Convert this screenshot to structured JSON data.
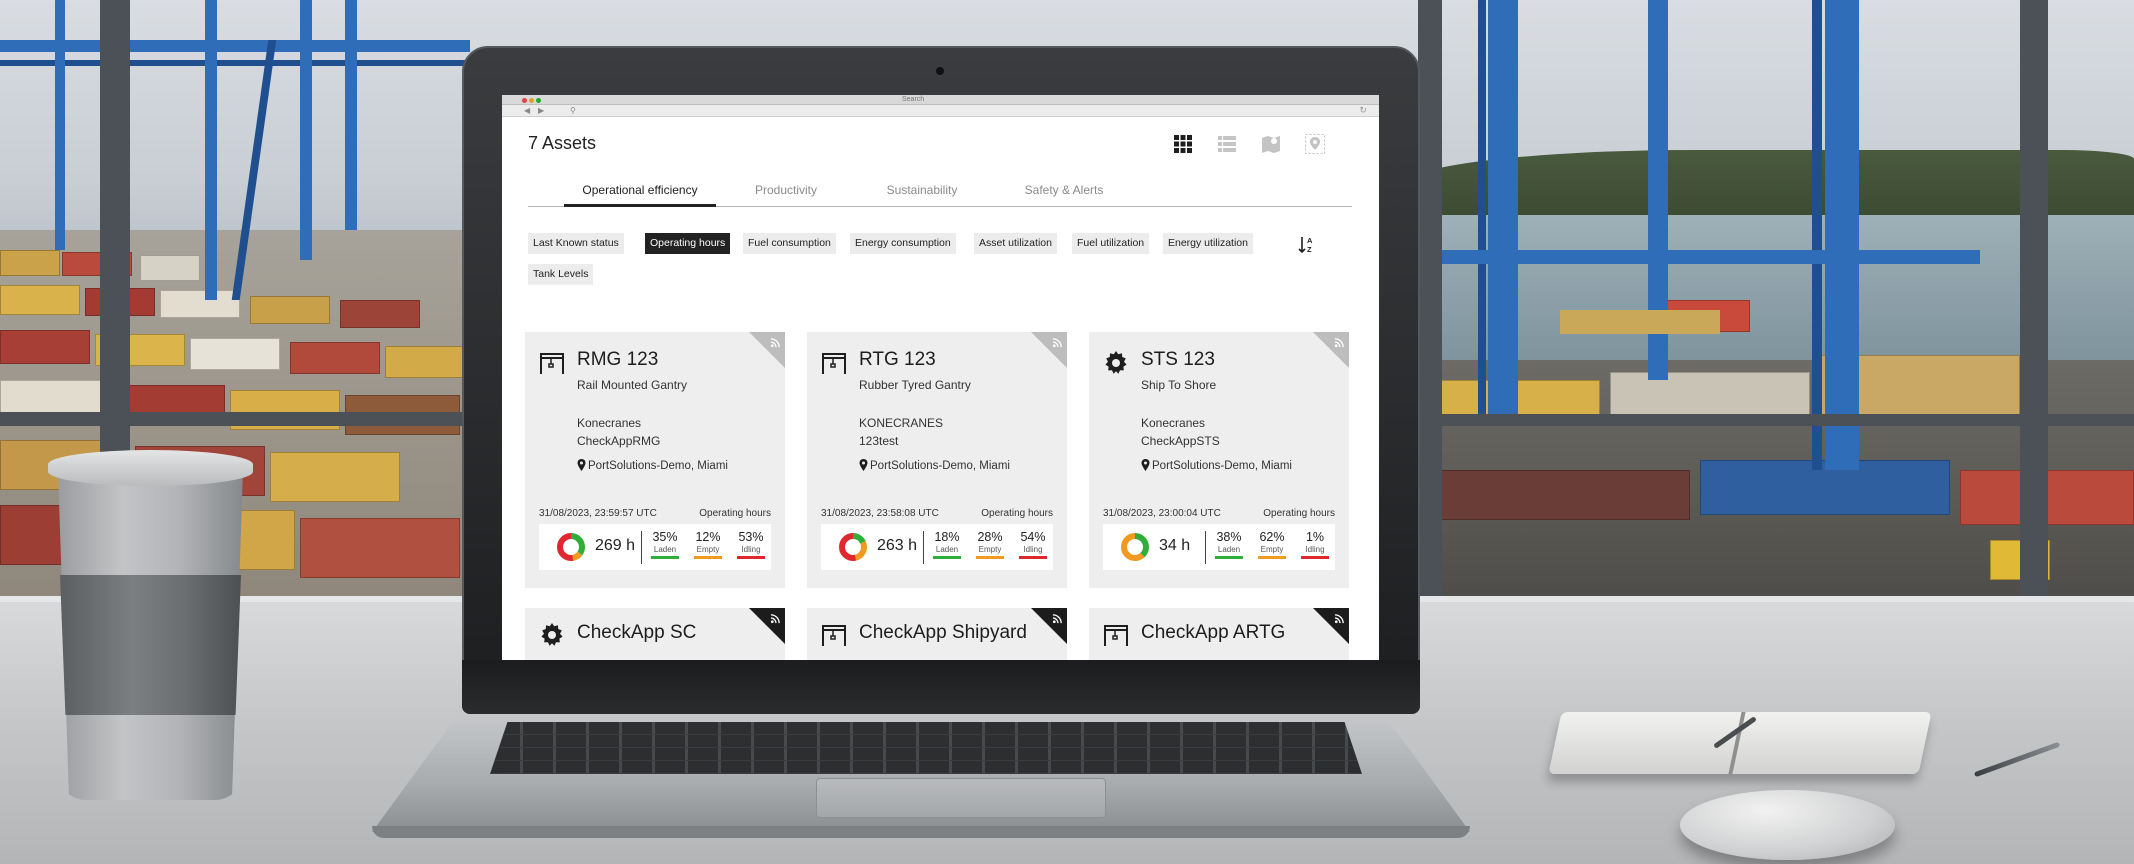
{
  "browser": {
    "title": "Search"
  },
  "header": {
    "assets_count_label": "7 Assets"
  },
  "view_icons": [
    "grid-view",
    "list-view",
    "map-view",
    "location-view"
  ],
  "tabs": [
    {
      "label": "Operational efficiency",
      "active": true
    },
    {
      "label": "Productivity",
      "active": false
    },
    {
      "label": "Sustainability",
      "active": false
    },
    {
      "label": "Safety & Alerts",
      "active": false
    }
  ],
  "filters": [
    {
      "label": "Last Known status",
      "active": false
    },
    {
      "label": "Operating hours",
      "active": true
    },
    {
      "label": "Fuel consumption",
      "active": false
    },
    {
      "label": "Energy consumption",
      "active": false
    },
    {
      "label": "Asset utilization",
      "active": false
    },
    {
      "label": "Fuel utilization",
      "active": false
    },
    {
      "label": "Energy utilization",
      "active": false
    },
    {
      "label": "Tank Levels",
      "active": false
    }
  ],
  "status_colors": {
    "laden": "#2fae3a",
    "empty": "#f29a1f",
    "idling": "#e0262f",
    "dark": "#1c1c1c"
  },
  "cards": [
    {
      "name": "RMG 123",
      "type": "Rail Mounted Gantry",
      "maker": "Konecranes",
      "model": "CheckAppRMG",
      "location": "PortSolutions-Demo, Miami",
      "timestamp": "31/08/2023, 23:59:57 UTC",
      "metric_label": "Operating hours",
      "hours": "269 h",
      "icon": "gantry-icon",
      "laden_pct": "35%",
      "empty_pct": "12%",
      "idling_pct": "53%",
      "laden_label": "Laden",
      "empty_label": "Empty",
      "idling_label": "Idling",
      "shares": [
        0.35,
        0.12,
        0.53
      ]
    },
    {
      "name": "RTG 123",
      "type": "Rubber Tyred Gantry",
      "maker": "KONECRANES",
      "model": "123test",
      "location": "PortSolutions-Demo, Miami",
      "timestamp": "31/08/2023, 23:58:08 UTC",
      "metric_label": "Operating hours",
      "hours": "263 h",
      "icon": "gantry-icon",
      "laden_pct": "18%",
      "empty_pct": "28%",
      "idling_pct": "54%",
      "laden_label": "Laden",
      "empty_label": "Empty",
      "idling_label": "Idling",
      "shares": [
        0.18,
        0.28,
        0.54
      ]
    },
    {
      "name": "STS 123",
      "type": "Ship To Shore",
      "maker": "Konecranes",
      "model": "CheckAppSTS",
      "location": "PortSolutions-Demo, Miami",
      "timestamp": "31/08/2023, 23:00:04 UTC",
      "metric_label": "Operating hours",
      "hours": "34 h",
      "icon": "gear-icon",
      "laden_pct": "38%",
      "empty_pct": "62%",
      "idling_pct": "1%",
      "laden_label": "Laden",
      "empty_label": "Empty",
      "idling_label": "Idling",
      "shares": [
        0.38,
        0.62,
        0.01
      ]
    }
  ],
  "lower_cards": [
    {
      "name": "CheckApp SC",
      "icon": "gear-icon"
    },
    {
      "name": "CheckApp Shipyard",
      "icon": "gantry-icon"
    },
    {
      "name": "CheckApp ARTG",
      "icon": "gantry-icon"
    }
  ]
}
